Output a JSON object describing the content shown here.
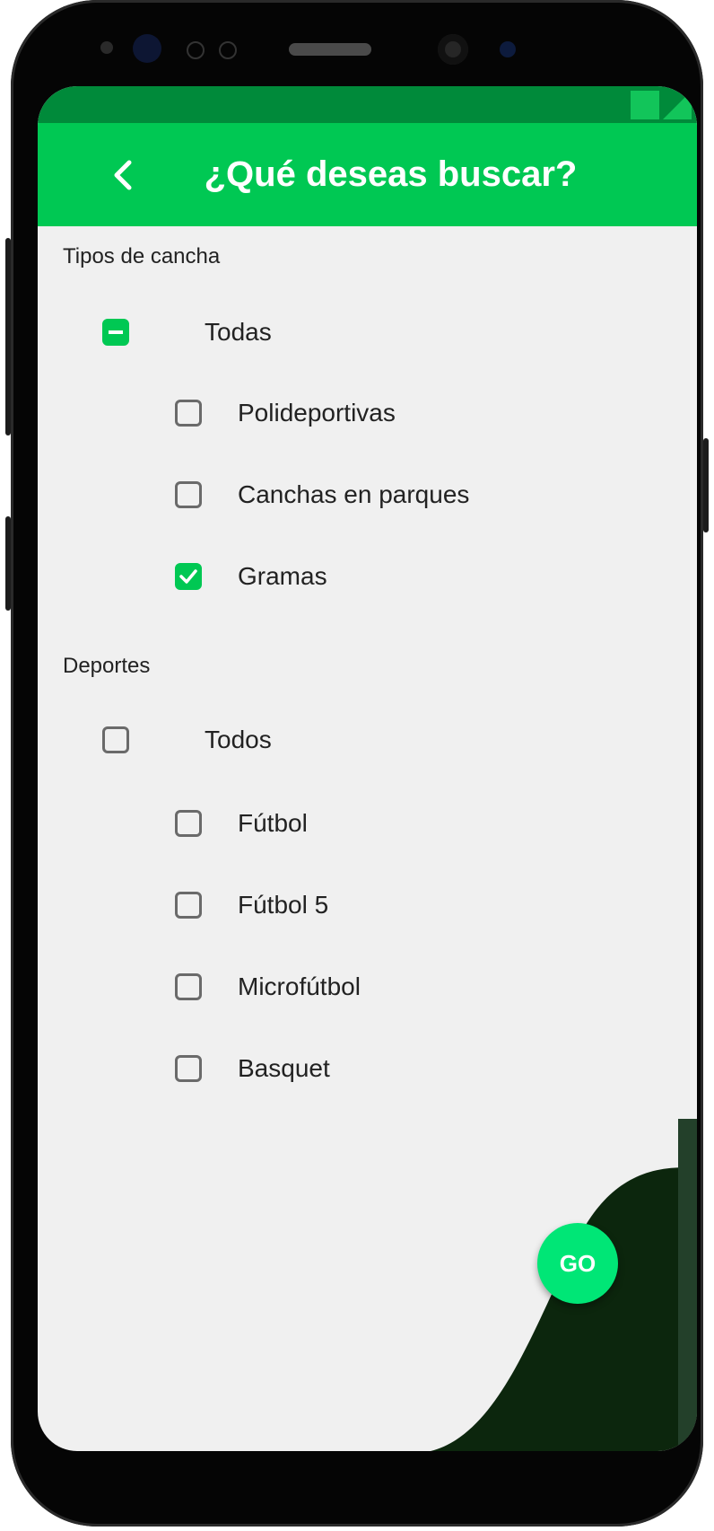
{
  "status_bar": {
    "icons": [
      "signal-icon",
      "battery-icon"
    ]
  },
  "app_bar": {
    "title": "¿Qué deseas buscar?",
    "back_icon": "chevron-left-icon",
    "background": "#00c853"
  },
  "sections": [
    {
      "label": "Tipos de cancha",
      "all": {
        "label": "Todas",
        "state": "indeterminate"
      },
      "items": [
        {
          "label": "Polideportivas",
          "checked": false
        },
        {
          "label": "Canchas en parques",
          "checked": false
        },
        {
          "label": "Gramas",
          "checked": true
        }
      ]
    },
    {
      "label": "Deportes",
      "all": {
        "label": "Todos",
        "state": "unchecked"
      },
      "items": [
        {
          "label": "Fútbol",
          "checked": false
        },
        {
          "label": "Fútbol 5",
          "checked": false
        },
        {
          "label": "Microfútbol",
          "checked": false
        },
        {
          "label": "Basquet",
          "checked": false
        }
      ]
    }
  ],
  "fab": {
    "label": "GO",
    "color": "#00e676"
  },
  "colors": {
    "accent": "#00c853",
    "dark_wave": "#0c260d",
    "background": "#f0f0f0"
  }
}
